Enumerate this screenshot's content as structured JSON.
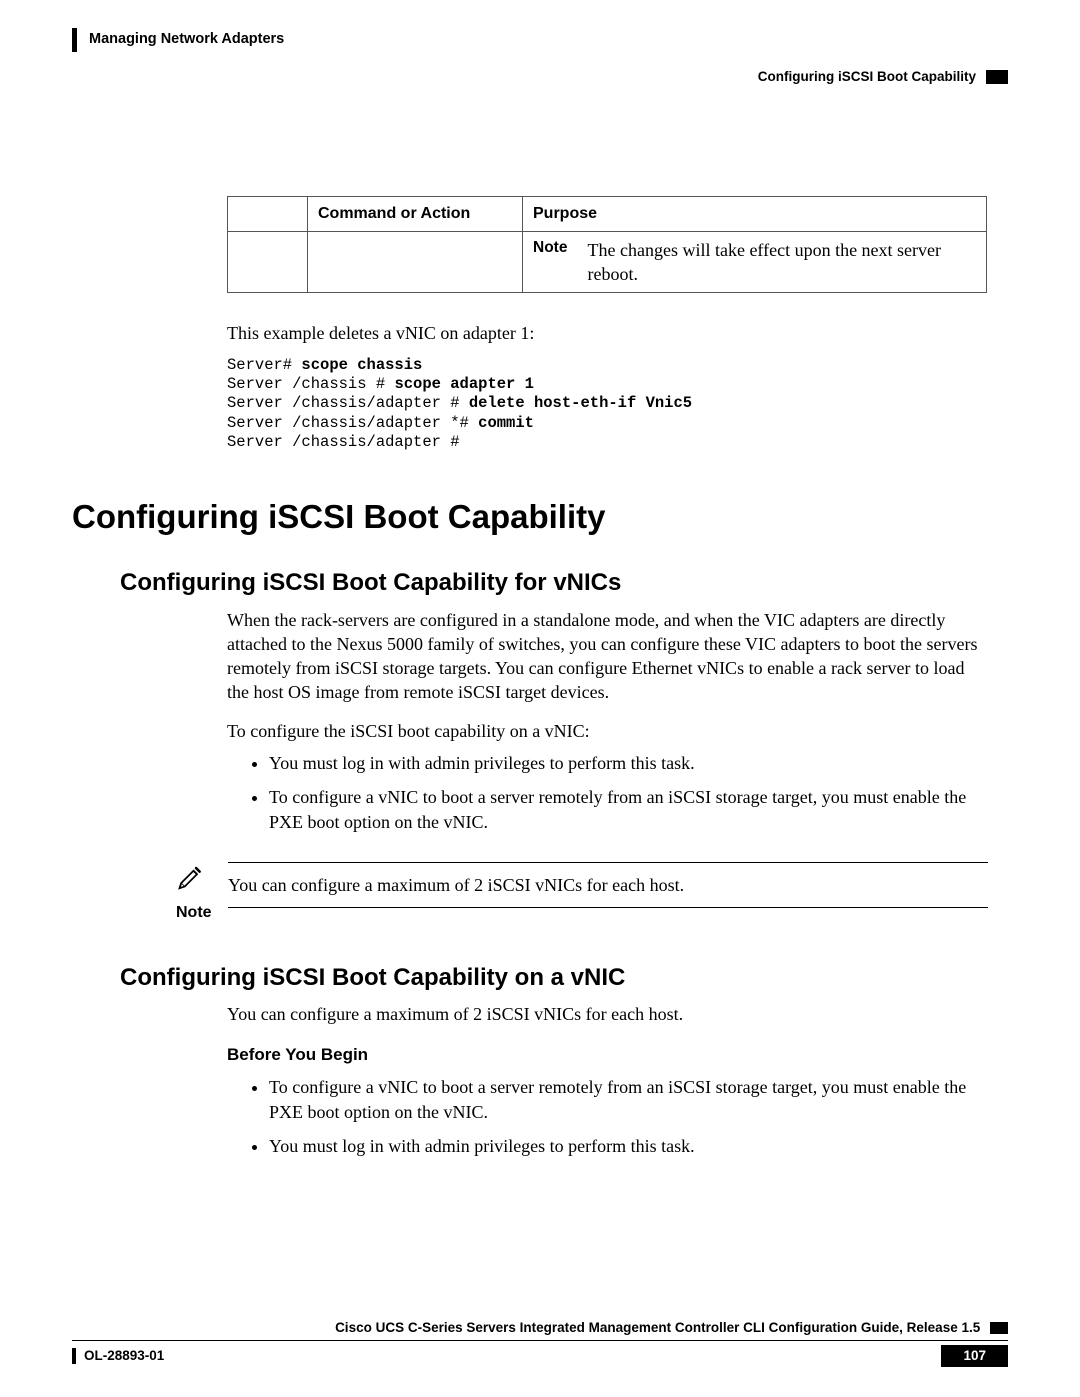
{
  "header": {
    "chapter": "Managing Network Adapters",
    "section": "Configuring iSCSI Boot Capability"
  },
  "table": {
    "headers": {
      "col0": "",
      "col1": "Command or Action",
      "col2": "Purpose"
    },
    "row0": {
      "note_label": "Note",
      "note_text": "The changes will take effect upon the next server reboot."
    }
  },
  "example_intro": "This example deletes a vNIC on adapter 1:",
  "code": {
    "l1a": "Server# ",
    "l1b": "scope chassis",
    "l2a": "Server /chassis # ",
    "l2b": "scope adapter 1",
    "l3a": "Server /chassis/adapter # ",
    "l3b": "delete host-eth-if Vnic5",
    "l4a": "Server /chassis/adapter *# ",
    "l4b": "commit",
    "l5": "Server /chassis/adapter #"
  },
  "h1": "Configuring iSCSI Boot Capability",
  "h2a": "Configuring iSCSI Boot Capability for vNICs",
  "p1": "When the rack-servers are configured in a standalone mode, and when the VIC adapters are directly attached to the Nexus 5000 family of switches, you can configure these VIC adapters to boot the servers remotely from iSCSI storage targets. You can configure Ethernet vNICs to enable a rack server to load the host OS image from remote iSCSI target devices.",
  "p2": "To configure the iSCSI boot capability on a vNIC:",
  "bullets_a": {
    "b1": "You must log in with admin privileges to perform this task.",
    "b2": "To configure a vNIC to boot a server remotely from an iSCSI storage target, you must enable the PXE boot option on the vNIC."
  },
  "note_callout": {
    "label": "Note",
    "text": "You can configure a maximum of 2 iSCSI vNICs for each host."
  },
  "h2b": "Configuring iSCSI Boot Capability on a vNIC",
  "p3": "You can configure a maximum of 2 iSCSI vNICs for each host.",
  "byb": "Before You Begin",
  "bullets_b": {
    "b1": "To configure a vNIC to boot a server remotely from an iSCSI storage target, you must enable the PXE boot option on the vNIC.",
    "b2": "You must log in with admin privileges to perform this task."
  },
  "footer": {
    "doc_title": "Cisco UCS C-Series Servers Integrated Management Controller CLI Configuration Guide, Release 1.5",
    "doc_id": "OL-28893-01",
    "page": "107"
  }
}
